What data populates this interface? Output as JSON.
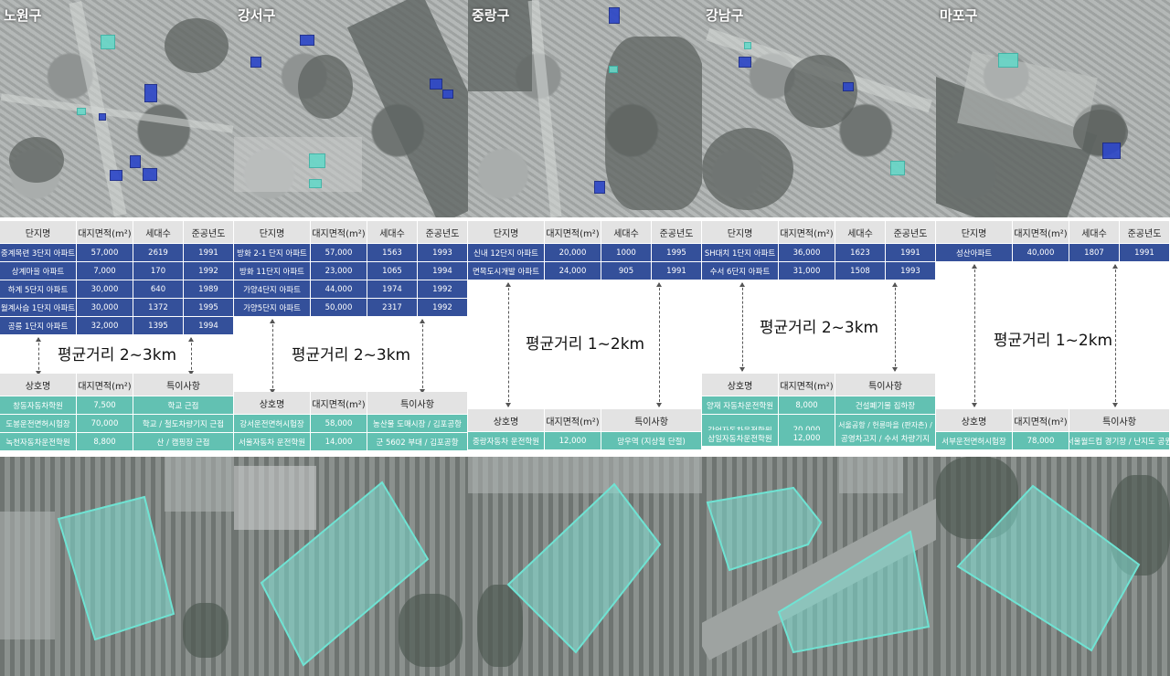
{
  "colors": {
    "complex_row": "#34509a",
    "business_row": "#62c1b2",
    "header": "#e3e3e3",
    "site_fill": "#7fded1"
  },
  "headers": {
    "complex": [
      "단지명",
      "대지면적(m²)",
      "세대수",
      "준공년도"
    ],
    "business": [
      "상호명",
      "대지면적(m²)",
      "특이사항"
    ]
  },
  "columns": [
    {
      "district": "노원구",
      "complexes": [
        [
          "중계목련 3단지 아파트",
          "57,000",
          "2619",
          "1991"
        ],
        [
          "상계마을 아파트",
          "7,000",
          "170",
          "1992"
        ],
        [
          "하계 5단지 아파트",
          "30,000",
          "640",
          "1989"
        ],
        [
          "월계사슴 1단지 아파트",
          "30,000",
          "1372",
          "1995"
        ],
        [
          "공릉 1단지 아파트",
          "32,000",
          "1395",
          "1994"
        ]
      ],
      "distance": "평균거리 2~3km",
      "businesses": [
        [
          "창동자동차학원",
          "7,500",
          "학교  근접"
        ],
        [
          "도봉운전면허시험장",
          "70,000",
          "학교 / 철도차량기지 근접"
        ],
        [
          "녹천자동차운전학원",
          "8,800",
          "산 / 캠핑장 근접"
        ]
      ]
    },
    {
      "district": "강서구",
      "complexes": [
        [
          "방화 2-1 단지 아파트",
          "57,000",
          "1563",
          "1993"
        ],
        [
          "방화 11단지 아파트",
          "23,000",
          "1065",
          "1994"
        ],
        [
          "가양4단지 아파트",
          "44,000",
          "1974",
          "1992"
        ],
        [
          "가양5단지 아파트",
          "50,000",
          "2317",
          "1992"
        ]
      ],
      "distance": "평균거리 2~3km",
      "businesses": [
        [
          "강서운전면허시험장",
          "58,000",
          "농산물 도매시장 / 김포공항"
        ],
        [
          "서울자동차 운전학원",
          "14,000",
          "군 5602 부대 / 김포공항"
        ]
      ]
    },
    {
      "district": "중랑구",
      "complexes": [
        [
          "신내 12단지 아파트",
          "20,000",
          "1000",
          "1995"
        ],
        [
          "면목도시개발 아파트",
          "24,000",
          "905",
          "1991"
        ]
      ],
      "distance": "평균거리 1~2km",
      "businesses": [
        [
          "중랑자동차 운전학원",
          "12,000",
          "망우역 (지상철 단절)"
        ]
      ]
    },
    {
      "district": "강남구",
      "complexes": [
        [
          "SH대치 1단지 아파트",
          "36,000",
          "1623",
          "1991"
        ],
        [
          "수서 6단지 아파트",
          "31,000",
          "1508",
          "1993"
        ]
      ],
      "distance": "평균거리 2~3km",
      "businesses": [
        [
          "양재 자동차운전학원",
          "8,000",
          "건설폐기물 집하장"
        ],
        [
          "강언자동차운전학원",
          "20,000",
          "서울공항 / 헌릉마을 (판자촌) / 하천 / 위례신도시 /"
        ],
        [
          "삼일자동차운전학원",
          "12,000",
          "공영차고지 / 수서 차량기지"
        ]
      ]
    },
    {
      "district": "마포구",
      "complexes": [
        [
          "성산아파트",
          "40,000",
          "1807",
          "1991"
        ]
      ],
      "distance": "평균거리 1~2km",
      "businesses": [
        [
          "서부운전면허시험장",
          "78,000",
          "서울월드컵 경기장 / 난지도 공원"
        ]
      ]
    }
  ]
}
